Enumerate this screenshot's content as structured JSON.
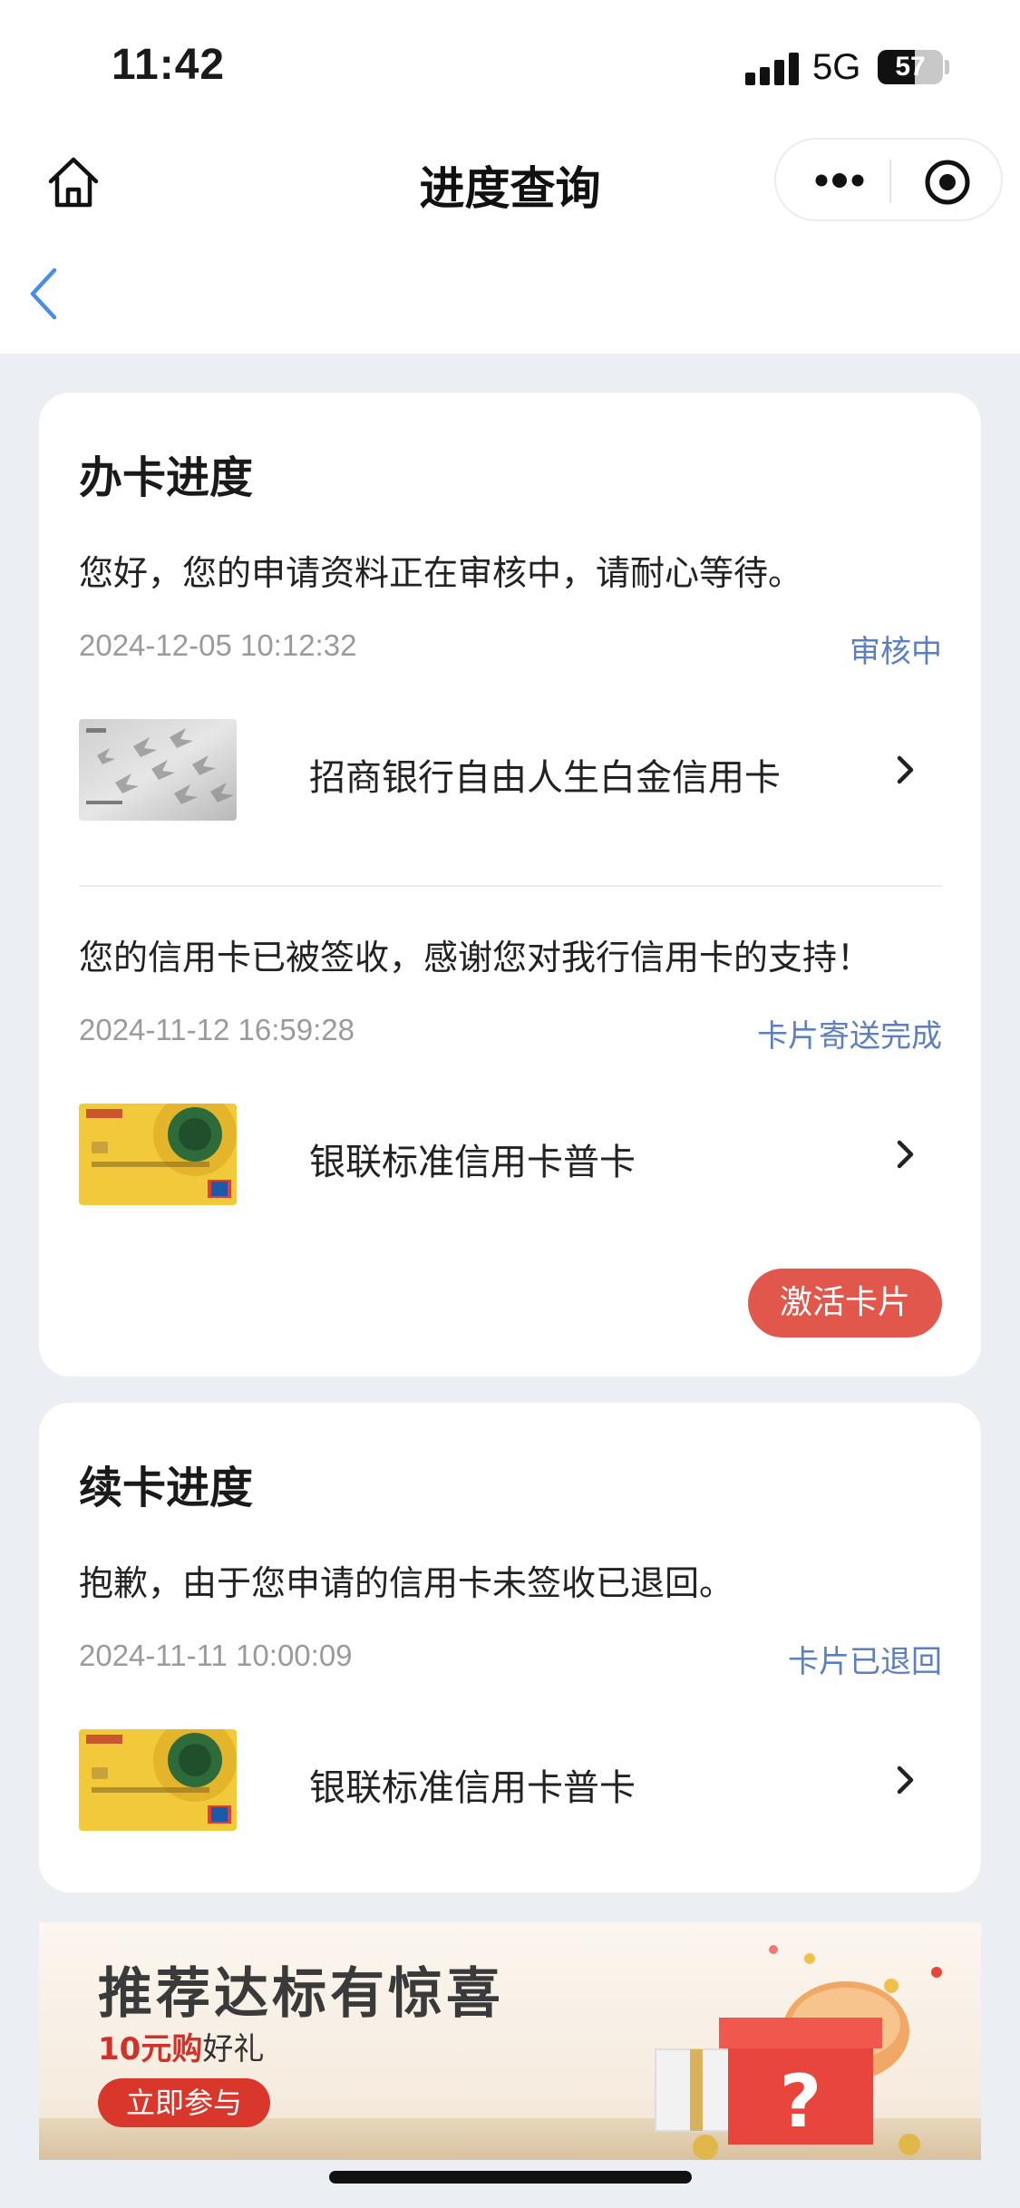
{
  "status_bar": {
    "time": "11:42",
    "network": "5G",
    "battery": "57",
    "battery_fraction": 0.57
  },
  "nav": {
    "title": "进度查询",
    "icons": [
      "home-icon",
      "more-icon",
      "target-icon",
      "back-icon"
    ]
  },
  "apply_section": {
    "title": "办卡进度",
    "records": [
      {
        "message": "您好，您的申请资料正在审核中，请耐心等待。",
        "timestamp": "2024-12-05 10:12:32",
        "status": "审核中",
        "card_name": "招商银行自由人生白金信用卡",
        "card_style": "platinum"
      },
      {
        "message": "您的信用卡已被签收，感谢您对我行信用卡的支持！",
        "timestamp": "2024-11-12 16:59:28",
        "status": "卡片寄送完成",
        "card_name": "银联标准信用卡普卡",
        "card_style": "gold"
      }
    ],
    "action_button": "激活卡片"
  },
  "renew_section": {
    "title": "续卡进度",
    "records": [
      {
        "message": "抱歉，由于您申请的信用卡未签收已退回。",
        "timestamp": "2024-11-11 10:00:09",
        "status": "卡片已退回",
        "card_name": "银联标准信用卡普卡",
        "card_style": "gold"
      }
    ]
  },
  "banner": {
    "title": "推荐达标有惊喜",
    "highlight": "10元购",
    "subtitle_rest": "好礼",
    "button": "立即参与"
  },
  "colors": {
    "status_blue": "#5b7fbf",
    "accent_red": "#e2574c",
    "page_bg": "#ebeef2"
  }
}
